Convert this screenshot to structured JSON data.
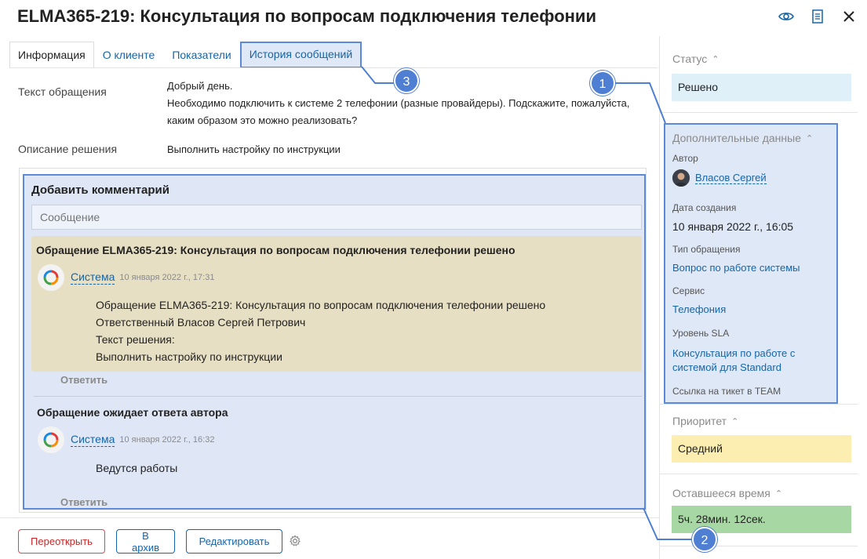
{
  "header": {
    "title": "ELMA365-219: Консультация по вопросам подключения телефонии"
  },
  "tabs": [
    {
      "label": "Информация"
    },
    {
      "label": "О клиенте"
    },
    {
      "label": "Показатели"
    },
    {
      "label": "История сообщений"
    }
  ],
  "info": {
    "request_label": "Текст обращения",
    "request_lines": [
      "Добрый день.",
      "Необходимо подключить к системе 2 телефонии (разные провайдеры). Подскажите, пожалуйста,",
      "каким образом это можно реализовать?"
    ],
    "solution_label": "Описание решения",
    "solution_value": "Выполнить настройку по инструкции"
  },
  "comments": {
    "add_title": "Добавить комментарий",
    "input_placeholder": "Сообщение",
    "items": [
      {
        "title": "Обращение ELMA365-219: Консультация по вопросам подключения телефонии решено",
        "author": "Система",
        "time": "10 января 2022 г., 17:31",
        "lines": [
          "Обращение ELMA365-219: Консультация по вопросам подключения телефонии решено",
          "Ответственный Власов Сергей Петрович",
          "Текст решения:",
          "Выполнить настройку по инструкции"
        ],
        "reply": "Ответить"
      },
      {
        "title": "Обращение ожидает ответа автора",
        "author": "Система",
        "time": "10 января 2022 г., 16:32",
        "lines": [
          "Ведутся работы"
        ],
        "reply": "Ответить"
      }
    ]
  },
  "footer": {
    "reopen": "Переоткрыть",
    "archive": "В архив",
    "edit": "Редактировать"
  },
  "sidebar": {
    "status_title": "Статус",
    "status_value": "Решено",
    "extra_title": "Дополнительные данные",
    "author_label": "Автор",
    "author_name": "Власов Сергей",
    "created_label": "Дата создания",
    "created_value": "10 января 2022 г., 16:05",
    "type_label": "Тип обращения",
    "type_value": "Вопрос по работе системы",
    "service_label": "Сервис",
    "service_value": "Телефония",
    "sla_label": "Уровень SLA",
    "sla_value_1": "Консультация по работе с",
    "sla_value_2": "системой для Standard",
    "team_label": "Ссылка на тикет в TEAM",
    "priority_title": "Приоритет",
    "priority_value": "Средний",
    "remaining_title": "Оставшееся время",
    "remaining_value": "5ч. 28мин. 12сек."
  },
  "callouts": [
    "1",
    "2",
    "3"
  ],
  "colors": {
    "accent": "#4f7fd3",
    "link": "#1565a8",
    "status_bg": "#dff0f8",
    "priority_bg": "#fbeeb0",
    "remaining_bg": "#a7d7a3",
    "comment_yellow": "#e7dfc4",
    "danger": "#c62828"
  }
}
